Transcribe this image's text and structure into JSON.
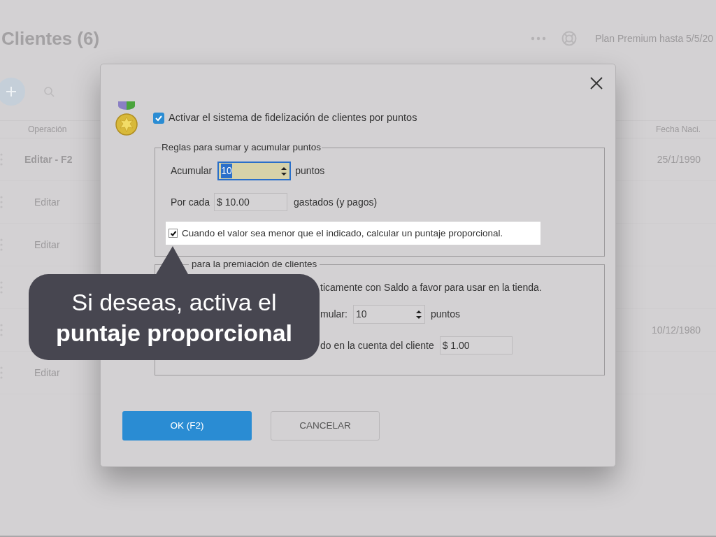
{
  "background": {
    "title": "Clientes (6)",
    "plan": "Plan Premium hasta 5/5/20",
    "columns": [
      "Operación",
      "Fecha Naci."
    ],
    "rows": [
      {
        "action": "Editar - F2",
        "date": "25/1/1990"
      },
      {
        "action": "Editar"
      },
      {
        "action": "Editar"
      },
      {},
      {
        "date": "10/12/1980"
      },
      {
        "action": "Editar"
      }
    ]
  },
  "dialog": {
    "enable": {
      "label": "Activar el sistema de fidelización de clientes por puntos",
      "checked": true
    },
    "rules": {
      "legend": "Reglas para sumar y acumular puntos",
      "accumulate_label": "Acumular",
      "accumulate_value": "10",
      "accumulate_unit": "puntos",
      "per_label": "Por cada",
      "per_value": "$ 10.00",
      "per_unit": "gastados (y pagos)",
      "proportional": {
        "label": "Cuando el valor sea menor que el indicado, calcular un puntaje proporcional.",
        "checked": true
      }
    },
    "rewards": {
      "legend": "para la premiación de clientes",
      "line": "ticamente con Saldo a favor para usar en la tienda.",
      "points_label": "mular:",
      "points_value": "10",
      "points_unit": "puntos",
      "credit_label": "do en la cuenta del cliente",
      "credit_value": "$ 1.00"
    },
    "buttons": [
      {
        "label": "OK (F2)",
        "kind": "primary"
      },
      {
        "label": "CANCELAR",
        "kind": "secondary"
      }
    ]
  },
  "callout": {
    "text": "Si deseas, activa el **puntaje proporcional**"
  }
}
